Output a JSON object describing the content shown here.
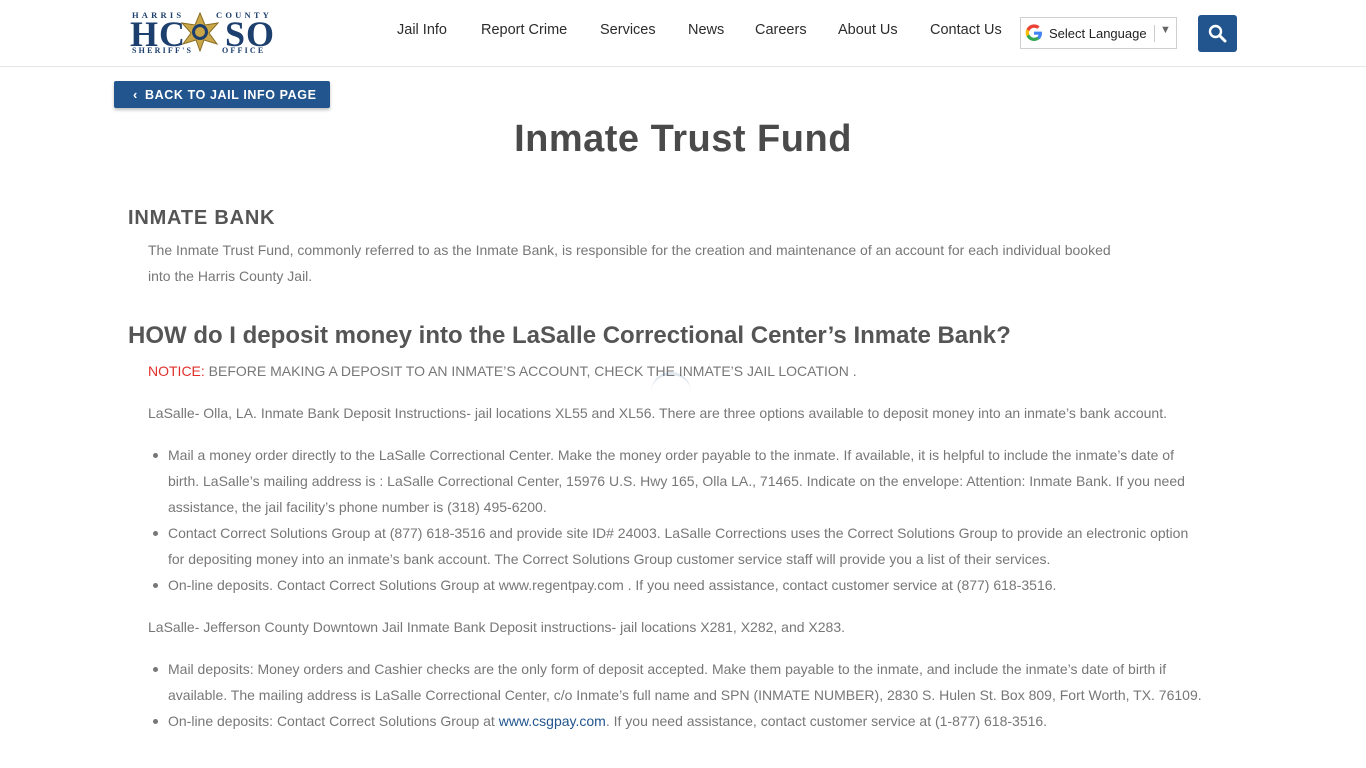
{
  "header": {
    "logo": {
      "top_text_left": "HARRIS",
      "top_text_right": "COUNTY",
      "letters_left": "HC",
      "letters_right": "SO",
      "bottom_text_left": "SHERIFF'S",
      "bottom_text_right": "OFFICE"
    },
    "nav": [
      "Jail Info",
      "Report Crime",
      "Services",
      "News",
      "Careers",
      "About Us",
      "Contact Us"
    ],
    "language_label": "Select Language",
    "language_arrow": "▼",
    "search_icon": "search-icon",
    "accent": "#22558e"
  },
  "back_button": {
    "chevron": "‹",
    "label": "BACK TO JAIL INFO PAGE"
  },
  "page_title": "Inmate Trust Fund",
  "section1": {
    "heading": "INMATE BANK",
    "line1": "The Inmate Trust Fund, commonly referred to as the Inmate Bank, is responsible for the creation and maintenance of an account for each individual booked",
    "line2": "into the Harris County Jail."
  },
  "section2": {
    "heading": "HOW do I deposit money into the LaSalle Correctional Center’s Inmate Bank?",
    "notice_label": "NOTICE:",
    "notice_text": " BEFORE MAKING A DEPOSIT TO AN INMATE’S ACCOUNT, CHECK THE INMATE’S JAIL LOCATION .",
    "olla_intro": "LaSalle- Olla, LA. Inmate Bank Deposit Instructions- jail locations XL55 and XL56. There are three options available to deposit money into an inmate’s bank account.",
    "olla_items": [
      [
        "Mail a money order directly to the LaSalle Correctional Center. Make the money order payable to the inmate. If available, it is helpful to include the inmate’s date of",
        "birth. LaSalle’s mailing address is : LaSalle Correctional Center, 15976 U.S. Hwy 165, Olla LA., 71465. Indicate on the envelope: Attention: Inmate Bank. If you need",
        "assistance, the jail facility’s phone number is (318) 495-6200."
      ],
      [
        "Contact Correct Solutions Group at (877) 618-3516 and provide site ID# 24003. LaSalle Corrections uses the Correct Solutions Group to provide an electronic option",
        "for depositing money into an inmate’s bank account. The Correct Solutions Group customer service staff will provide you a list of their services."
      ],
      [
        "On-line deposits. Contact Correct Solutions Group at www.regentpay.com . If you need assistance, contact customer service at (877) 618-3516."
      ]
    ],
    "jefferson_intro": "LaSalle- Jefferson County Downtown Jail Inmate Bank Deposit instructions- jail locations X281, X282, and X283.",
    "jefferson_item1_line1": "Mail deposits: Money orders and Cashier checks are the only form of deposit accepted. Make them payable to the inmate, and include the inmate’s date of birth if",
    "jefferson_item1_line2": "available. The mailing address is LaSalle Correctional Center, c/o Inmate’s full name and SPN (INMATE NUMBER), 2830 S. Hulen St. Box 809, Fort Worth, TX. 76109.",
    "jefferson_item2_pre": "On-line deposits: Contact Correct Solutions Group at ",
    "jefferson_item2_link": "www.csgpay.com",
    "jefferson_item2_post": ". If you need assistance, contact customer service at (1-877) 618-3516."
  }
}
